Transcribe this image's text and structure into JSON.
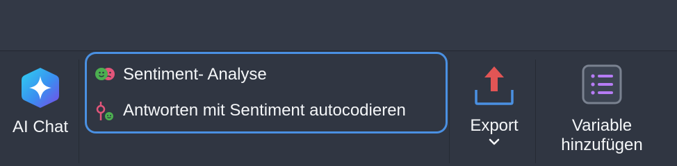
{
  "toolbar": {
    "ai_chat": {
      "label": "AI Chat",
      "icon": "ai-sparkle-icon"
    },
    "sentiment_group": {
      "items": [
        {
          "label": "Sentiment- Analyse",
          "icon": "sentiment-faces-icon"
        },
        {
          "label": "Antworten mit Sentiment autocodieren",
          "icon": "sentiment-autocode-icon"
        }
      ],
      "border_color": "#4a90e2"
    },
    "export": {
      "label": "Export",
      "icon": "upload-export-icon",
      "dropdown_icon": "chevron-down-icon"
    },
    "add_variable": {
      "label": "Variable\nhinzufügen",
      "icon": "list-variable-icon"
    }
  },
  "colors": {
    "background": "#303642",
    "accent_blue": "#4a90e2",
    "export_red": "#e25555",
    "list_purple": "#b67cf5"
  }
}
